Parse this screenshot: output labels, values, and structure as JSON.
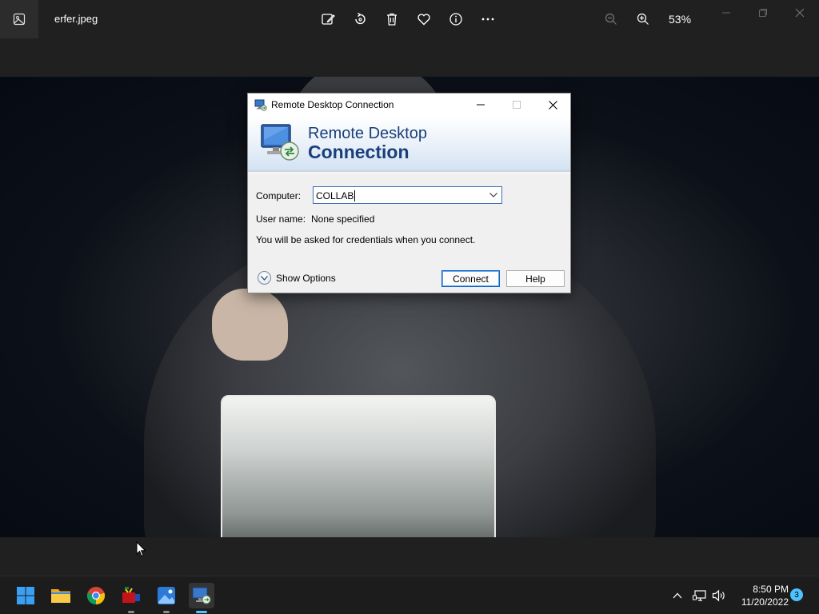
{
  "photos": {
    "filename": "erfer.jpeg",
    "zoom_level": "53%",
    "toolbar_icons": [
      "edit-image-icon",
      "rotate-icon",
      "delete-icon",
      "favorite-icon",
      "info-icon",
      "more-icon"
    ],
    "zoom_icons": [
      "zoom-out-icon",
      "zoom-in-icon"
    ]
  },
  "rdc": {
    "title": "Remote Desktop Connection",
    "banner_line1": "Remote Desktop",
    "banner_line2": "Connection",
    "computer_label": "Computer:",
    "computer_value": "COLLAB",
    "username_label": "User name:",
    "username_value": "None specified",
    "info_text": "You will be asked for credentials when you connect.",
    "show_options": "Show Options",
    "connect_label": "Connect",
    "help_label": "Help"
  },
  "taskbar": {
    "apps": [
      "start-icon",
      "file-explorer-icon",
      "chrome-icon",
      "media-app-icon",
      "photos-icon",
      "remote-desktop-icon"
    ],
    "time": "8:50 PM",
    "date": "11/20/2022",
    "notification_count": "3"
  },
  "colors": {
    "accent": "#4cc2ff",
    "rdc_banner_text": "#1a3f7a",
    "dark_bg": "#202020"
  }
}
